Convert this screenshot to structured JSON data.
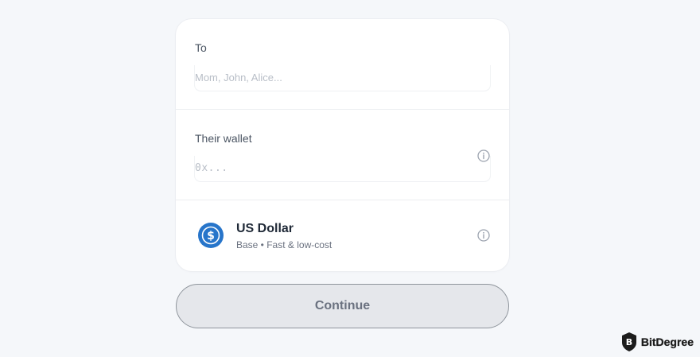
{
  "form": {
    "to": {
      "label": "To",
      "placeholder": "Mom, John, Alice...",
      "value": ""
    },
    "wallet": {
      "label": "Their wallet",
      "placeholder": "0x...",
      "value": ""
    },
    "asset": {
      "name": "US Dollar",
      "subtitle": "Base • Fast & low-cost",
      "icon": "usd-coin-icon"
    }
  },
  "actions": {
    "continue_label": "Continue"
  },
  "watermark": {
    "text": "BitDegree"
  },
  "colors": {
    "background": "#f5f7fa",
    "card": "#ffffff",
    "coin_blue": "#2775ca",
    "button_bg": "#e5e7eb",
    "button_border": "#8f959c"
  }
}
